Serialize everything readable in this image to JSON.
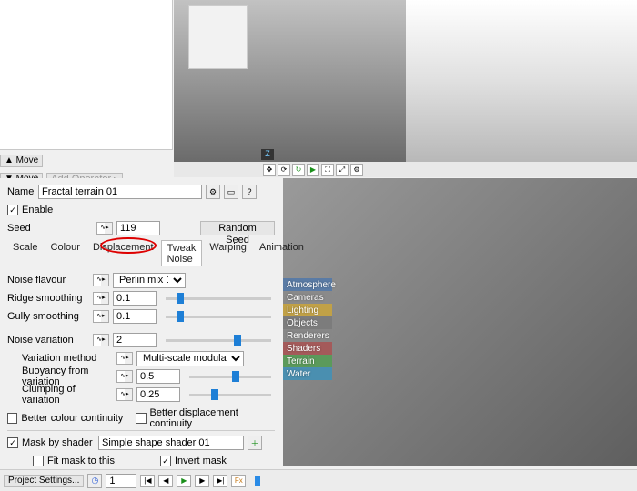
{
  "buttons": {
    "move_up": "▲  Move",
    "move_down": "▼  Move",
    "add_operator": "Add Operator",
    "random_seed": "Random Seed",
    "project_settings": "Project Settings..."
  },
  "name_row": {
    "label": "Name",
    "value": "Fractal terrain 01"
  },
  "enable": {
    "label": "Enable",
    "checked": true
  },
  "seed_row": {
    "label": "Seed",
    "value": "119"
  },
  "tabs": [
    "Scale",
    "Colour",
    "Displacement",
    "Tweak Noise",
    "Warping",
    "Animation"
  ],
  "active_tab": "Tweak Noise",
  "fields": {
    "noise_flavour": {
      "label": "Noise flavour",
      "value": "Perlin mix 1"
    },
    "ridge_smoothing": {
      "label": "Ridge smoothing",
      "value": "0.1",
      "slider": 0.1
    },
    "gully_smoothing": {
      "label": "Gully smoothing",
      "value": "0.1",
      "slider": 0.1
    },
    "noise_variation": {
      "label": "Noise variation",
      "value": "2",
      "slider": 0.65
    },
    "variation_method": {
      "label": "Variation method",
      "value": "Multi-scale modulator"
    },
    "buoyancy": {
      "label": "Buoyancy from variation",
      "value": "0.5",
      "slider": 0.52
    },
    "clumping": {
      "label": "Clumping of variation",
      "value": "0.25",
      "slider": 0.27
    }
  },
  "continuity": {
    "colour": {
      "label": "Better colour continuity",
      "checked": false
    },
    "displacement": {
      "label": "Better displacement continuity",
      "checked": false
    }
  },
  "mask": {
    "label": "Mask by shader",
    "checked": true,
    "value": "Simple shape shader 01",
    "fit": {
      "label": "Fit mask to this",
      "checked": false
    },
    "invert": {
      "label": "Invert mask",
      "checked": true
    }
  },
  "categories": [
    {
      "label": "Atmosphere",
      "color": "#5a7ba5"
    },
    {
      "label": "Cameras",
      "color": "#8a8a8a"
    },
    {
      "label": "Lighting",
      "color": "#c1a147"
    },
    {
      "label": "Objects",
      "color": "#7c7c7c"
    },
    {
      "label": "Renderers",
      "color": "#878787"
    },
    {
      "label": "Shaders",
      "color": "#a45a5a"
    },
    {
      "label": "Terrain",
      "color": "#5b9a5b"
    },
    {
      "label": "Water",
      "color": "#4a8fb0"
    }
  ],
  "bottom": {
    "frame": "1"
  }
}
